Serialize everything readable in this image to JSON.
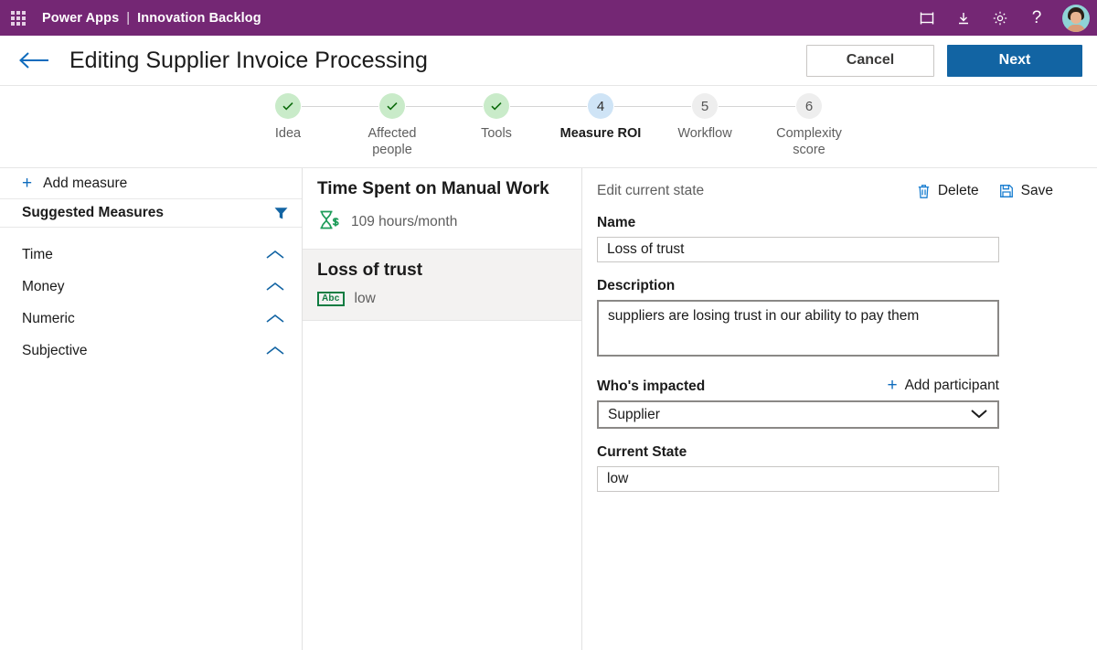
{
  "suite_bar": {
    "waffle": "app-launcher-icon",
    "product": "Power Apps",
    "separator": "|",
    "app_name": "Innovation Backlog",
    "icons": [
      {
        "name": "frame-icon",
        "label": "Frame"
      },
      {
        "name": "download-icon",
        "label": "Download"
      },
      {
        "name": "gear-icon",
        "label": "Settings"
      },
      {
        "name": "help-icon",
        "label": "?"
      }
    ],
    "avatar": "user-avatar",
    "background": "#742774"
  },
  "title_bar": {
    "back": "back-arrow-icon",
    "title": "Editing Supplier Invoice Processing",
    "cancel_label": "Cancel",
    "next_label": "Next",
    "primary_color": "#1264a3"
  },
  "stepper": {
    "steps": [
      {
        "num": "1",
        "label": "Idea",
        "state": "done"
      },
      {
        "num": "2",
        "label": "Affected people",
        "state": "done"
      },
      {
        "num": "3",
        "label": "Tools",
        "state": "done"
      },
      {
        "num": "4",
        "label": "Measure ROI",
        "state": "current"
      },
      {
        "num": "5",
        "label": "Workflow",
        "state": "todo"
      },
      {
        "num": "6",
        "label": "Complexity score",
        "state": "todo"
      }
    ],
    "done_color": "#c9ebc9",
    "current_color": "#cfe4f6",
    "todo_color": "#eeeeee"
  },
  "sidebar": {
    "add_measure_label": "Add measure",
    "header": "Suggested Measures",
    "filter_icon": "filter-icon",
    "categories": [
      {
        "label": "Time",
        "expanded": true
      },
      {
        "label": "Money",
        "expanded": true
      },
      {
        "label": "Numeric",
        "expanded": true
      },
      {
        "label": "Subjective",
        "expanded": true
      }
    ]
  },
  "measures": [
    {
      "title": "Time Spent on Manual Work",
      "icon": "hourglass-dollar-icon",
      "value": "109 hours/month",
      "selected": false
    },
    {
      "title": "Loss of trust",
      "icon": "abc-text-icon",
      "value": "low",
      "selected": true
    }
  ],
  "detail": {
    "header": "Edit current state",
    "delete_label": "Delete",
    "save_label": "Save",
    "name_label": "Name",
    "name_value": "Loss of trust",
    "description_label": "Description",
    "description_value": "suppliers are losing trust in our ability to pay them",
    "impacted_label": "Who's impacted",
    "add_participant_label": "Add participant",
    "participant_value": "Supplier",
    "current_state_label": "Current State",
    "current_state_value": "low"
  }
}
